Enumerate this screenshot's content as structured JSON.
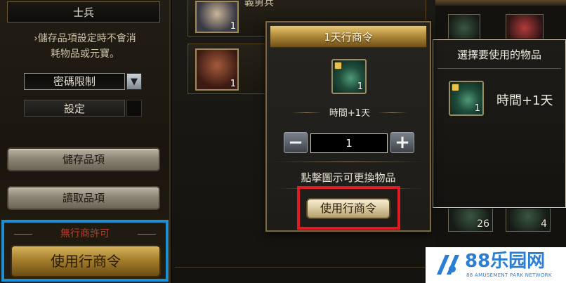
{
  "left": {
    "soldier_label": "士兵",
    "note_line1": "›儲存品項設定時不會消",
    "note_line2": "耗物品或元寶。",
    "password_select": "密碼限制",
    "password_arrow": "▼",
    "settings_label": "設定",
    "save_button": "儲存品項",
    "load_button": "讀取品項",
    "no_permit_label": "無行商許可",
    "use_permit_button": "使用行商令"
  },
  "middle": {
    "top_row_text": "義勇兵",
    "top_row_level": "1",
    "second_row_level": "1"
  },
  "dialog": {
    "title": "1天行商令",
    "item_qty": "1",
    "item_effect": "時間+1天",
    "minus_symbol": "−",
    "plus_symbol": "+",
    "quantity_value": "1",
    "hint": "點擊圖示可更換物品",
    "use_button": "使用行商令"
  },
  "tooltip": {
    "title": "選擇要使用的物品",
    "item_qty": "1",
    "item_effect": "時間+1天"
  },
  "right_grid": {
    "counts": [
      "26",
      "4"
    ]
  },
  "watermark": {
    "brand": "88乐园网",
    "subtitle": "88 AMUSEMENT PARK NETWORK"
  },
  "colors": {
    "highlight_red": "#e01b24",
    "focus_blue": "#1e8fd0",
    "gold": "#b9923f",
    "warning_red": "#c23a2a",
    "watermark_blue": "#2a7fd4"
  }
}
